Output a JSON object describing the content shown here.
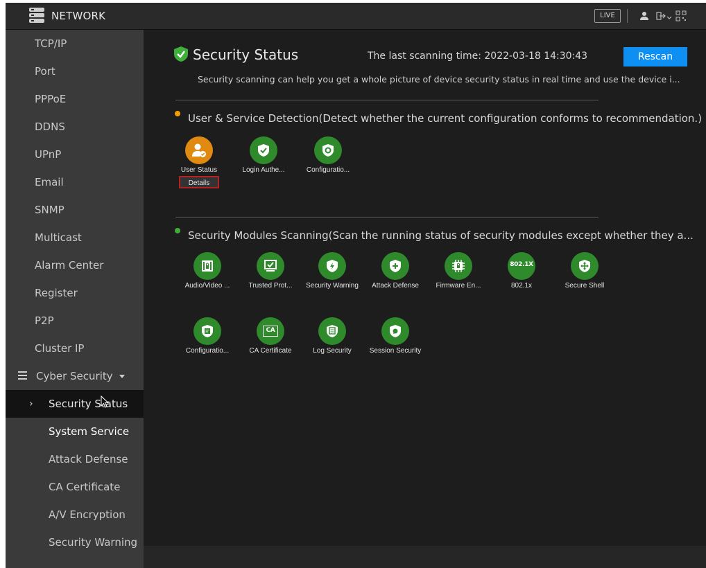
{
  "topbar": {
    "title": "NETWORK",
    "live_label": "LIVE",
    "icons": [
      "menu-icon",
      "user-icon",
      "logout-icon",
      "qr-code-icon"
    ]
  },
  "sidebar": {
    "items": [
      {
        "label": "TCP/IP"
      },
      {
        "label": "Port"
      },
      {
        "label": "PPPoE"
      },
      {
        "label": "DDNS"
      },
      {
        "label": "UPnP"
      },
      {
        "label": "Email"
      },
      {
        "label": "SNMP"
      },
      {
        "label": "Multicast"
      },
      {
        "label": "Alarm Center"
      },
      {
        "label": "Register"
      },
      {
        "label": "P2P"
      },
      {
        "label": "Cluster IP"
      }
    ],
    "group": {
      "label": "Cyber Security",
      "icon": "list-icon",
      "expanded": true
    },
    "subitems": [
      {
        "label": "Security Status",
        "active": true
      },
      {
        "label": "System Service"
      },
      {
        "label": "Attack Defense"
      },
      {
        "label": "CA Certificate"
      },
      {
        "label": "A/V Encryption"
      },
      {
        "label": "Security Warning"
      }
    ]
  },
  "main": {
    "title": "Security Status",
    "title_icon": "shield-check-icon",
    "scan_time": "The last scanning time: 2022-03-18 14:30:43",
    "rescan_label": "Rescan",
    "description": "Security scanning can help you get a whole picture of device security status in real time and use the device i...",
    "sections": [
      {
        "title": "User & Service Detection(Detect whether the current configuration conforms to recommendation.)",
        "status_color": "#f0a000",
        "modules": [
          {
            "label": "User Status",
            "icon": "user-warning-icon",
            "color": "#e08a12",
            "details_label": "Details"
          },
          {
            "label": "Login Authe...",
            "icon": "shield-check-icon",
            "color": "#2f8a2c"
          },
          {
            "label": "Configuratio...",
            "icon": "shield-gear-icon",
            "color": "#2f8a2c"
          }
        ]
      },
      {
        "title": "Security Modules Scanning(Scan the running status of security modules except whether they a...",
        "status_color": "#3fae3a",
        "modules": [
          {
            "label": "Audio/Video ...",
            "icon": "av-lock-icon"
          },
          {
            "label": "Trusted Prot...",
            "icon": "monitor-check-icon"
          },
          {
            "label": "Security Warning",
            "icon": "shield-bolt-icon"
          },
          {
            "label": "Attack Defense",
            "icon": "shield-plus-icon"
          },
          {
            "label": "Firmware En...",
            "icon": "chip-lock-icon"
          },
          {
            "label": "802.1x",
            "icon": "802-1x-icon",
            "icon_text": "802.1X"
          },
          {
            "label": "Secure Shell",
            "icon": "shield-move-icon"
          },
          {
            "label": "Configuratio...",
            "icon": "shield-doc-icon"
          },
          {
            "label": "CA Certificate",
            "icon": "ca-certificate-icon",
            "icon_text": "CA"
          },
          {
            "label": "Log Security",
            "icon": "shield-log-icon"
          },
          {
            "label": "Session Security",
            "icon": "shield-chat-icon"
          }
        ]
      }
    ]
  },
  "colors": {
    "accent_blue": "#0e8ff2",
    "ok_green": "#2f8a2c",
    "warn_orange": "#e08a12",
    "sidebar_bg": "#3a3a3a",
    "main_bg": "#1d1d1d"
  }
}
